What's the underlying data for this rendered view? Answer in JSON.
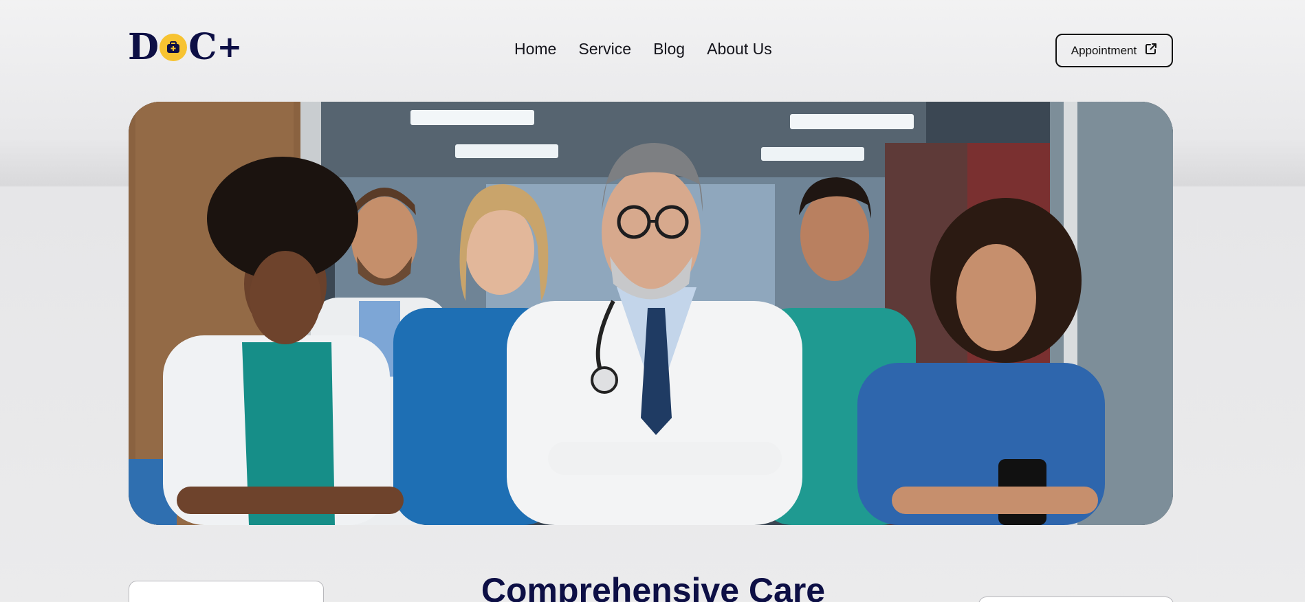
{
  "brand": {
    "logo_letter_1": "D",
    "logo_letter_3": "C",
    "logo_plus": "+",
    "accent_color": "#f7c331",
    "primary_color": "#0d0f45"
  },
  "nav": {
    "items": [
      {
        "label": "Home"
      },
      {
        "label": "Service"
      },
      {
        "label": "Blog"
      },
      {
        "label": "About Us"
      }
    ]
  },
  "header": {
    "appointment_label": "Appointment",
    "appointment_icon": "external-link-icon"
  },
  "hero": {
    "image_subject": "team of six medical professionals standing with arms crossed in a hospital corridor",
    "icons": [
      "medical-bag-icon"
    ]
  },
  "section": {
    "title": "Comprehensive Care"
  }
}
